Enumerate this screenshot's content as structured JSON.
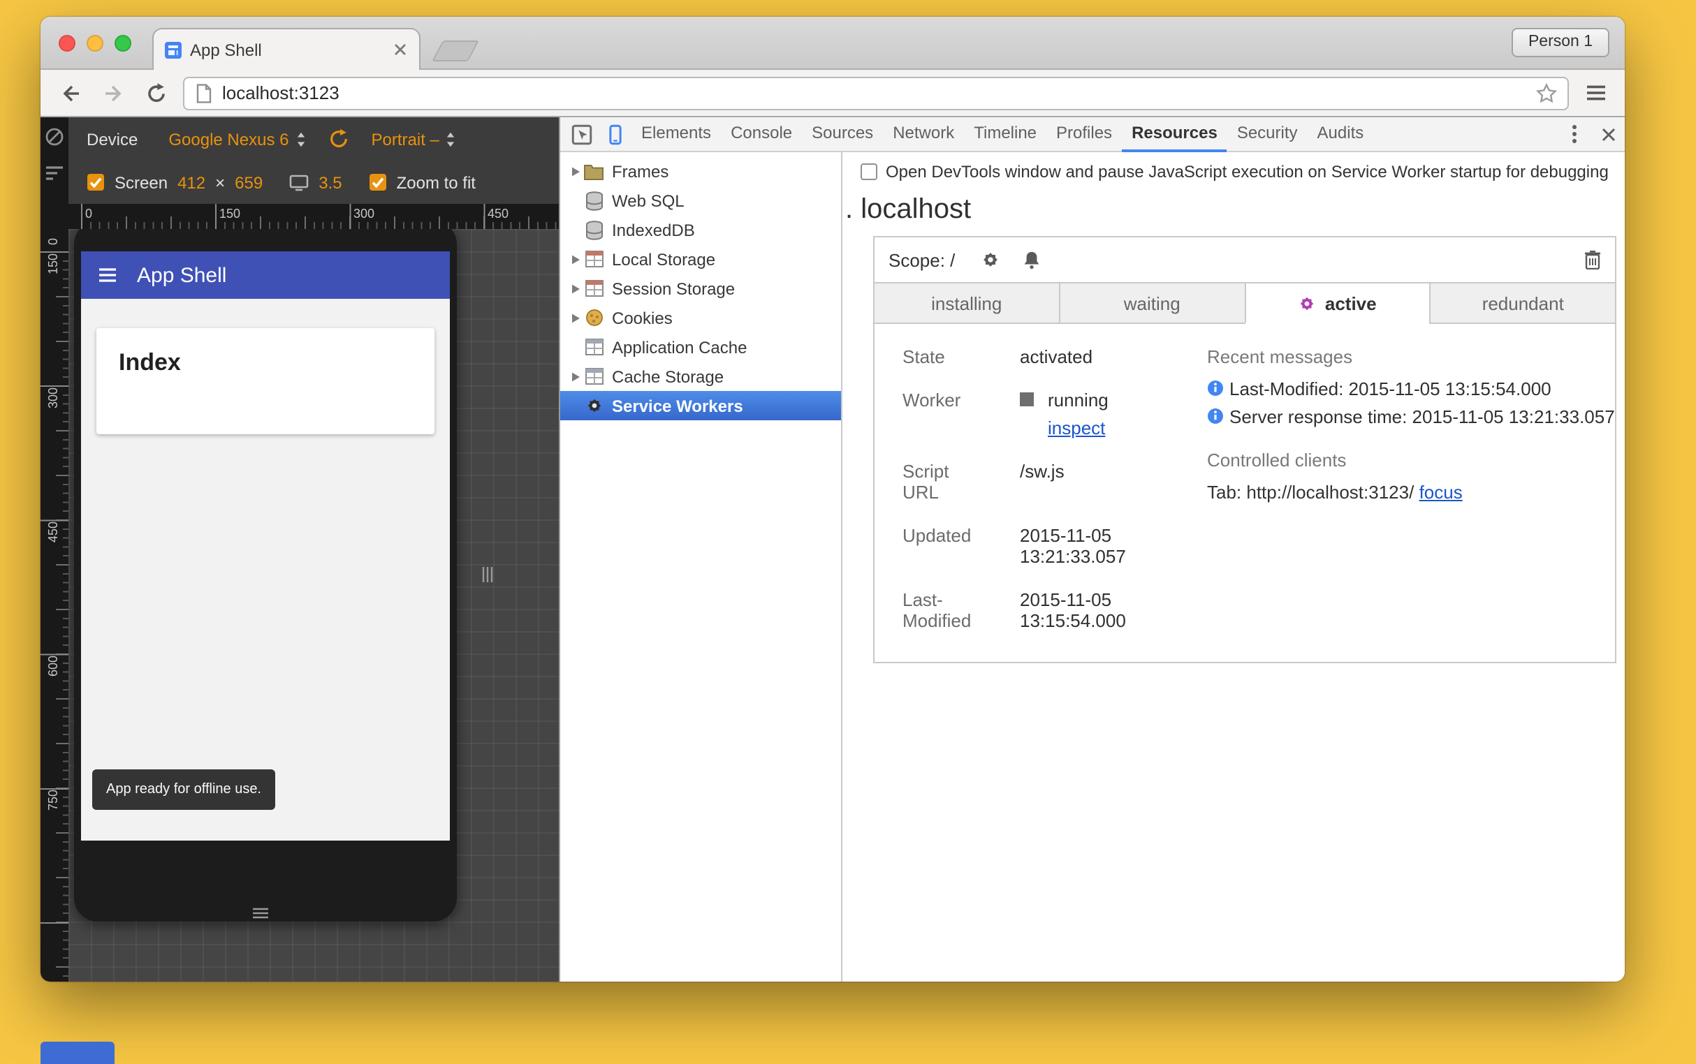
{
  "browser": {
    "tab_title": "App Shell",
    "url": "localhost:3123",
    "profile_button": "Person 1"
  },
  "device_toolbar": {
    "device_label": "Device",
    "device_model": "Google Nexus 6",
    "orientation": "Portrait –",
    "screen_label": "Screen",
    "screen_width": "412",
    "times": "×",
    "screen_height": "659",
    "dpr": "3.5",
    "zoom_label": "Zoom to fit"
  },
  "rulers": {
    "horizontal": [
      "0",
      "150",
      "300",
      "450"
    ],
    "vertical": [
      "0",
      "150",
      "300",
      "450",
      "600",
      "750"
    ]
  },
  "app": {
    "header_title": "App Shell",
    "page_heading": "Index",
    "toast": "App ready for offline use."
  },
  "devtools": {
    "tabs": [
      "Elements",
      "Console",
      "Sources",
      "Network",
      "Timeline",
      "Profiles",
      "Resources",
      "Security",
      "Audits"
    ],
    "selected_tab": "Resources",
    "pause_checkbox_label": "Open DevTools window and pause JavaScript execution on Service Worker startup for debugging",
    "sidebar": {
      "items": [
        {
          "label": "Frames",
          "icon": "folder-icon",
          "expandable": true
        },
        {
          "label": "Web SQL",
          "icon": "database-icon",
          "expandable": false
        },
        {
          "label": "IndexedDB",
          "icon": "database-icon",
          "expandable": false
        },
        {
          "label": "Local Storage",
          "icon": "table-icon",
          "expandable": true
        },
        {
          "label": "Session Storage",
          "icon": "table-icon",
          "expandable": true
        },
        {
          "label": "Cookies",
          "icon": "cookie-icon",
          "expandable": true
        },
        {
          "label": "Application Cache",
          "icon": "table-icon",
          "expandable": false
        },
        {
          "label": "Cache Storage",
          "icon": "table-icon",
          "expandable": true
        },
        {
          "label": "Service Workers",
          "icon": "gear-icon",
          "expandable": false,
          "selected": true
        }
      ]
    },
    "main": {
      "origin_heading": ". localhost",
      "scope_label": "Scope: /",
      "sw_tabs": [
        "installing",
        "waiting",
        "active",
        "redundant"
      ],
      "active_sw_tab": "active",
      "fields": {
        "state_label": "State",
        "state_value": "activated",
        "worker_label": "Worker",
        "worker_status": "running",
        "inspect_link": "inspect",
        "script_url_label": "Script URL",
        "script_url_value": "/sw.js",
        "updated_label": "Updated",
        "updated_value": "2015-11-05 13:21:33.057",
        "last_modified_label": "Last-Modified",
        "last_modified_value": "2015-11-05 13:15:54.000"
      },
      "recent_messages_heading": "Recent messages",
      "messages": [
        "Last-Modified: 2015-11-05 13:15:54.000",
        "Server response time: 2015-11-05 13:21:33.057"
      ],
      "controlled_clients_heading": "Controlled clients",
      "client_tab_prefix": "Tab: http://localhost:3123/",
      "focus_link": "focus"
    }
  },
  "colors": {
    "accent_orange": "#E8920E",
    "app_header_blue": "#3F51B5",
    "devtools_accent_blue": "#4285F4",
    "selection_blue": "#3B79D8",
    "active_gear_magenta": "#B23CB8"
  }
}
